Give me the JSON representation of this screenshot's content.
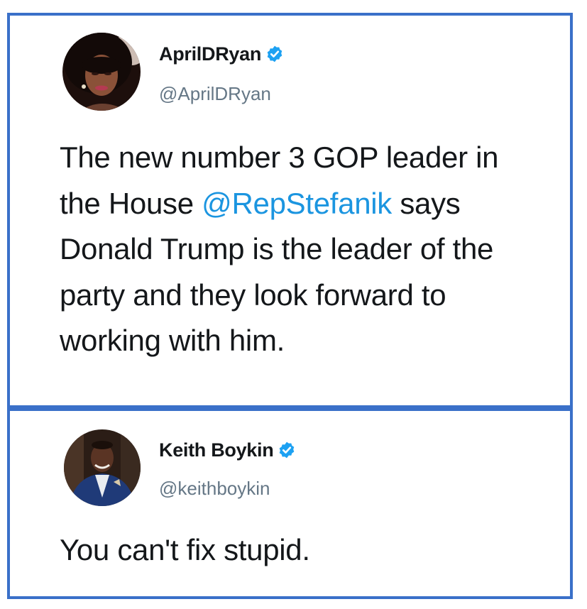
{
  "colors": {
    "frame_border": "#3a70c9",
    "verified_badge": "#1da1f2",
    "mention": "#1b95e0",
    "handle": "#657786",
    "text": "#14171a"
  },
  "tweets": [
    {
      "display_name": "AprilDRyan",
      "handle": "@AprilDRyan",
      "verified": true,
      "verified_icon": "verified-badge-icon",
      "text_before": "The new number 3 GOP leader in the House ",
      "mention": "@RepStefanik",
      "text_after": " says Donald Trump is the leader of the party and they look forward to working with him."
    },
    {
      "display_name": "Keith Boykin",
      "handle": "@keithboykin",
      "verified": true,
      "verified_icon": "verified-badge-icon",
      "text": "You can't fix stupid."
    }
  ]
}
